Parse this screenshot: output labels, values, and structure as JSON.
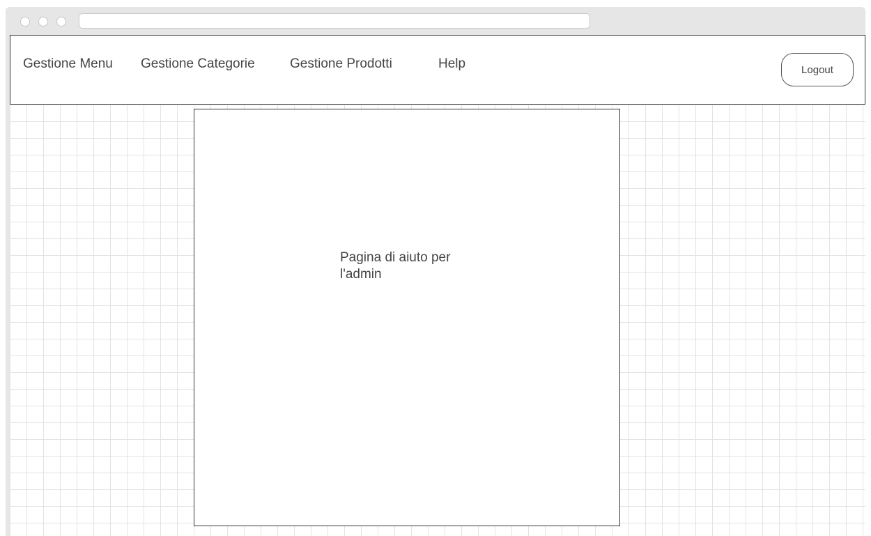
{
  "nav": {
    "items": [
      {
        "label": "Gestione Menu"
      },
      {
        "label": "Gestione Categorie"
      },
      {
        "label": "Gestione Prodotti"
      },
      {
        "label": "Help"
      }
    ],
    "logout_label": "Logout"
  },
  "help_panel": {
    "text": "Pagina di aiuto per l'admin"
  },
  "colors": {
    "border": "#333333",
    "text": "#444444",
    "grid": "#e3e3e3",
    "chrome": "#e6e6e6"
  }
}
